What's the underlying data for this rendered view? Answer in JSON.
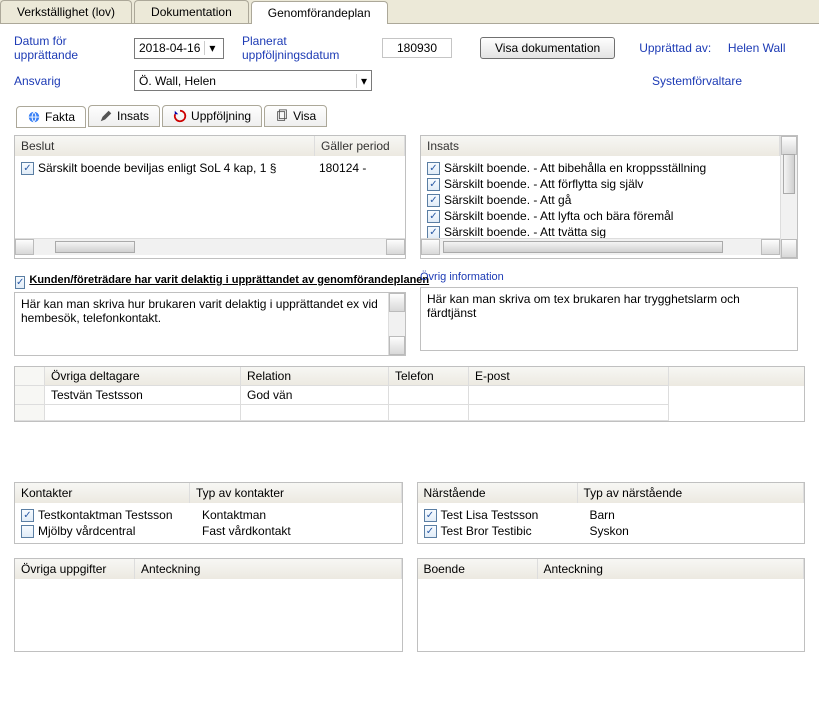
{
  "top_tabs": {
    "verk": "Verkställighet (lov)",
    "dok": "Dokumentation",
    "genom": "Genomförandeplan"
  },
  "header": {
    "date_label": "Datum för upprättande",
    "date_value": "2018-04-16",
    "planned_label": "Planerat uppföljningsdatum",
    "planned_value": "180930",
    "show_doc_btn": "Visa dokumentation",
    "uppr_label": "Upprättad av:",
    "uppr_value": "Helen Wall",
    "ansv_label": "Ansvarig",
    "ansv_value": "Ö. Wall, Helen",
    "sysforv": "Systemförvaltare"
  },
  "sub_tabs": {
    "fakta": "Fakta",
    "insats": "Insats",
    "uppf": "Uppföljning",
    "visa": "Visa"
  },
  "beslut": {
    "hdr_beslut": "Beslut",
    "hdr_period": "Gäller period",
    "r0": {
      "text": "Särskilt boende beviljas enligt SoL 4 kap, 1 §",
      "period": "180124 -"
    }
  },
  "insats_panel": {
    "hdr": "Insats",
    "rows": {
      "0": "Särskilt boende. - Att bibehålla en kroppsställning",
      "1": "Särskilt boende. - Att förflytta sig själv",
      "2": "Särskilt boende. - Att gå",
      "3": "Särskilt boende. - Att lyfta och bära föremål",
      "4": "Särskilt boende. - Att tvätta sig"
    }
  },
  "kund": {
    "title": "Kunden/företrädare har varit delaktig i upprättandet av genomförandeplanen",
    "body": "Här kan man skriva hur brukaren varit delaktig i upprättandet ex vid hembesök, telefonkontakt."
  },
  "ovrig_info": {
    "label": "Övrig information",
    "body": "Här kan man skriva om tex brukaren har trygghetslarm och färdtjänst"
  },
  "deltagare": {
    "h1": "Övriga deltagare",
    "h2": "Relation",
    "h3": "Telefon",
    "h4": "E-post",
    "r0": {
      "namn": "Testvän Testsson",
      "rel": "God vän"
    }
  },
  "kontakter": {
    "label": "Kontakter",
    "typ": "Typ av kontakter",
    "r0": {
      "namn": "Testkontaktman Testsson",
      "typ": "Kontaktman"
    },
    "r1": {
      "namn": "Mjölby vårdcentral",
      "typ": "Fast vårdkontakt"
    }
  },
  "narst": {
    "label": "Närstående",
    "typ": "Typ av närstående",
    "r0": {
      "namn": "Test Lisa Testsson",
      "typ": "Barn"
    },
    "r1": {
      "namn": "Test Bror Testibic",
      "typ": "Syskon"
    }
  },
  "ovriga_uppg": {
    "h0": "Övriga uppgifter",
    "h1": "Anteckning"
  },
  "boende": {
    "h0": "Boende",
    "h1": "Anteckning"
  }
}
